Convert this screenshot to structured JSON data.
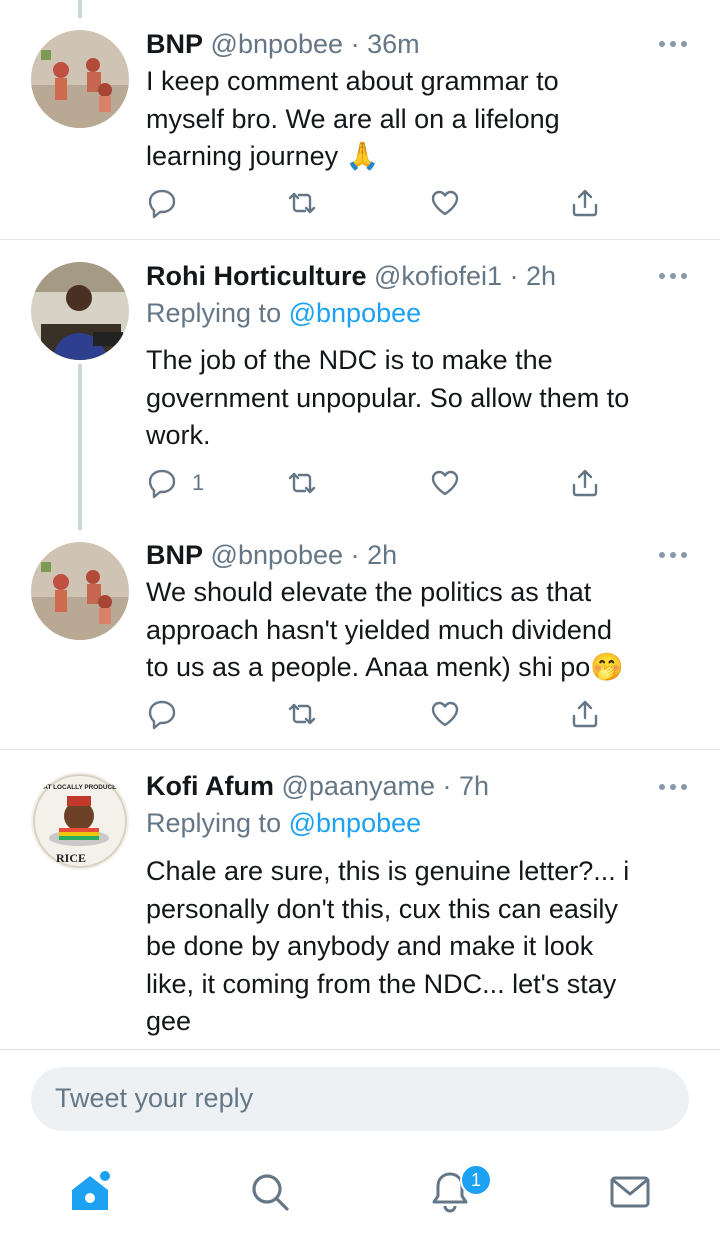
{
  "tweets": [
    {
      "name": "BNP",
      "handle": "@bnpobee",
      "time": "· 36m",
      "text_lines": [
        "I keep comment about grammar to",
        "myself bro. We are all on a lifelong",
        "learning journey 🙏"
      ],
      "reply_count": ""
    },
    {
      "name": "Rohi Horticulture",
      "handle": "@kofiofei1",
      "time": "· 2h",
      "replying_prefix": "Replying to",
      "replying_handle": "@bnpobee",
      "text_lines": [
        "The job of the NDC is to make the",
        "government unpopular. So allow them to",
        "work."
      ],
      "reply_count": "1"
    },
    {
      "name": "BNP",
      "handle": "@bnpobee",
      "time": "· 2h",
      "text_lines": [
        "We should elevate the politics as that",
        "approach hasn't yielded much dividend",
        "to us as a people. Anaa menk) shi po🤭"
      ],
      "reply_count": ""
    },
    {
      "name": "Kofi Afum",
      "handle": "@paanyame",
      "time": "· 7h",
      "replying_prefix": "Replying to",
      "replying_handle": "@bnpobee",
      "text_lines": [
        "Chale are sure, this is genuine letter?... i",
        "personally don't this, cux this can easily",
        "be done by anybody and make it look",
        "like, it coming from the NDC... let's stay",
        "gee"
      ],
      "avatar_text_top": "EAT LOCALLY PRODUCED",
      "avatar_text_bottom": "RICE"
    }
  ],
  "reply_box": {
    "placeholder": "Tweet your reply"
  },
  "tabbar": {
    "items": [
      "home-icon",
      "search-icon",
      "notifications-icon",
      "messages-icon"
    ],
    "notification_badge": "1"
  },
  "colors": {
    "accent": "#1da1f2",
    "secondary_text": "#657786",
    "divider": "#dfe5ea"
  }
}
